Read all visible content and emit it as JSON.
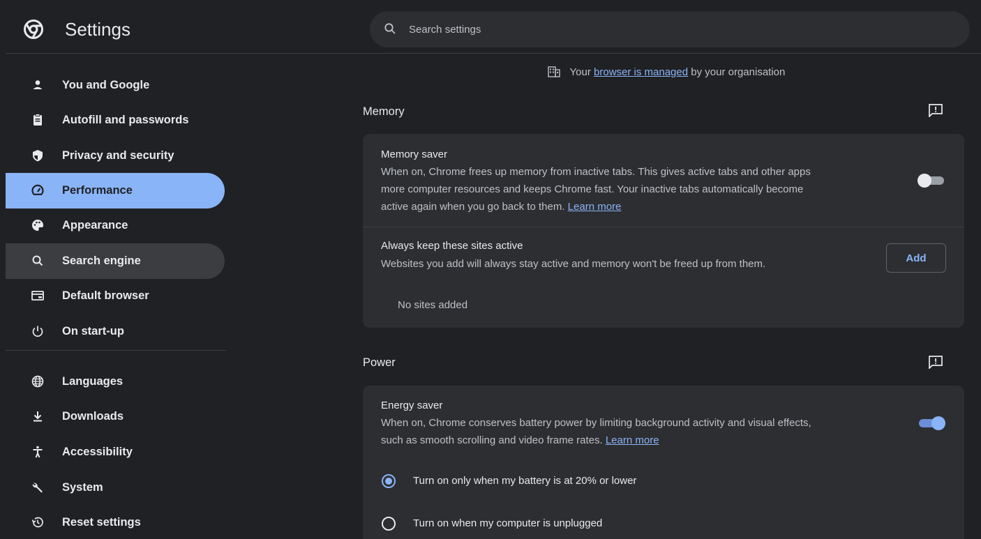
{
  "header": {
    "title": "Settings",
    "search_placeholder": "Search settings"
  },
  "sidebar": {
    "items": [
      {
        "label": "You and Google",
        "icon": "person-icon"
      },
      {
        "label": "Autofill and passwords",
        "icon": "clipboard-icon"
      },
      {
        "label": "Privacy and security",
        "icon": "shield-icon"
      },
      {
        "label": "Performance",
        "icon": "speedometer-icon",
        "state": "selected"
      },
      {
        "label": "Appearance",
        "icon": "palette-icon"
      },
      {
        "label": "Search engine",
        "icon": "search-icon",
        "state": "hovered"
      },
      {
        "label": "Default browser",
        "icon": "browser-window-icon"
      },
      {
        "label": "On start-up",
        "icon": "power-icon"
      },
      {
        "label": "Languages",
        "icon": "globe-icon"
      },
      {
        "label": "Downloads",
        "icon": "download-icon"
      },
      {
        "label": "Accessibility",
        "icon": "accessibility-icon"
      },
      {
        "label": "System",
        "icon": "wrench-icon"
      },
      {
        "label": "Reset settings",
        "icon": "history-icon"
      }
    ]
  },
  "main": {
    "managed_notice": {
      "prefix": "Your",
      "link": "browser is managed",
      "suffix": "by your organisation",
      "icon": "building-icon"
    },
    "memory": {
      "title": "Memory",
      "feedback_icon": "feedback-icon",
      "memory_saver": {
        "title": "Memory saver",
        "desc_line1": "When on, Chrome frees up memory from inactive tabs. This gives active tabs and other apps",
        "desc_line2": "more computer resources and keeps Chrome fast. Your inactive tabs automatically become",
        "desc_line3": "active again when you go back to them.",
        "learn_more": "Learn more",
        "enabled": false
      },
      "always_active": {
        "title": "Always keep these sites active",
        "desc": "Websites you add will always stay active and memory won't be freed up from them.",
        "add_label": "Add",
        "empty_label": "No sites added"
      }
    },
    "power": {
      "title": "Power",
      "feedback_icon": "feedback-icon",
      "energy_saver": {
        "title": "Energy saver",
        "desc_line1": "When on, Chrome conserves battery power by limiting background activity and visual effects,",
        "desc_line2": "such as smooth scrolling and video frame rates.",
        "learn_more": "Learn more",
        "enabled": true,
        "options": [
          {
            "label": "Turn on only when my battery is at 20% or lower",
            "selected": true
          },
          {
            "label": "Turn on when my computer is unplugged",
            "selected": false
          }
        ]
      }
    }
  },
  "colors": {
    "background": "#202124",
    "card": "#2d2e31",
    "accent": "#8ab4f8",
    "text": "#e8eaed",
    "secondary_text": "#bdc1c6"
  }
}
